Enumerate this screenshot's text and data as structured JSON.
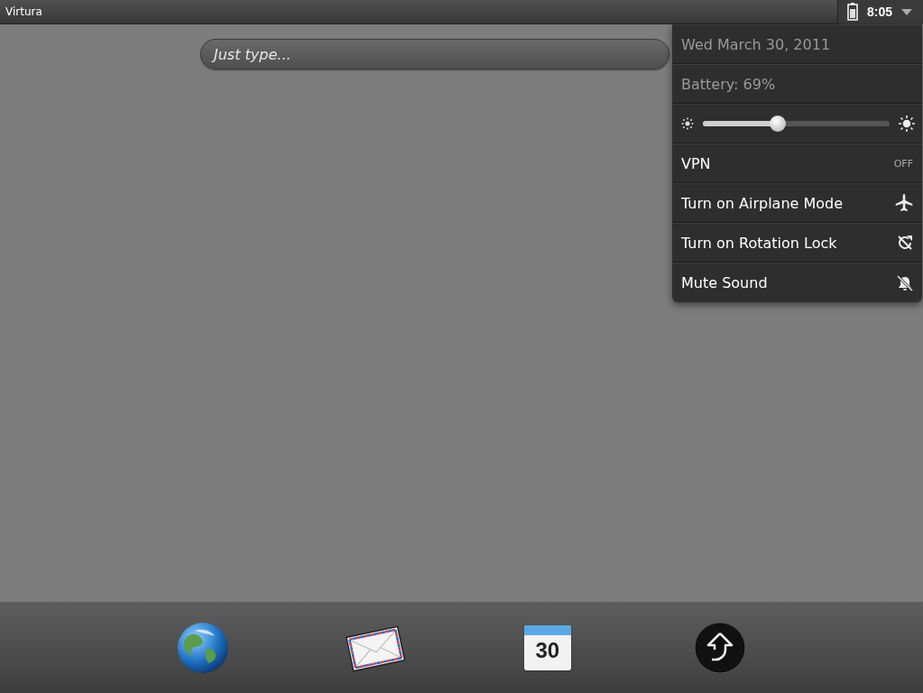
{
  "status_bar": {
    "app_title": "Virtura",
    "time": "8:05"
  },
  "search": {
    "placeholder": "Just type..."
  },
  "system_menu": {
    "date": "Wed March 30, 2011",
    "battery": "Battery: 69%",
    "brightness": {
      "level": 0.4
    },
    "items": [
      {
        "kind": "vpn",
        "label": "VPN",
        "value": "OFF"
      },
      {
        "kind": "airplane",
        "label": "Turn on Airplane Mode"
      },
      {
        "kind": "rotation",
        "label": "Turn on Rotation Lock"
      },
      {
        "kind": "mute",
        "label": "Mute Sound"
      }
    ]
  },
  "dock": [
    {
      "kind": "globe"
    },
    {
      "kind": "mail"
    },
    {
      "kind": "calendar",
      "day": "30"
    },
    {
      "kind": "launcher"
    }
  ]
}
